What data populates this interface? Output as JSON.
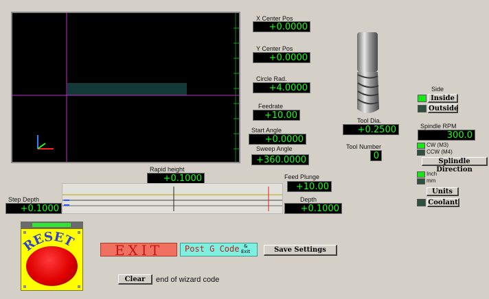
{
  "preview": {},
  "dros": {
    "x_center": {
      "label": "X Center Pos",
      "value": "+0.0000"
    },
    "y_center": {
      "label": "Y Center Pos",
      "value": "+0.0000"
    },
    "circle_rad": {
      "label": "Circle Rad.",
      "value": "+4.0000"
    },
    "feedrate": {
      "label": "Feedrate",
      "value": "+10.00"
    },
    "start_angle": {
      "label": "Start Angle",
      "value": "+0.0000"
    },
    "sweep_angle": {
      "label": "Sweep Angle",
      "value": "+360.0000"
    },
    "tool_dia": {
      "label": "Tool Dia.",
      "value": "+0.2500"
    },
    "tool_number": {
      "label": "Tool Number",
      "value": "0"
    },
    "spindle_rpm": {
      "label": "Spindle RPM",
      "value": "300.0"
    },
    "rapid_height": {
      "label": "Rapid height",
      "value": "+0.1000"
    },
    "feed_plunge": {
      "label": "Feed Plunge",
      "value": "+10.00"
    },
    "depth": {
      "label": "Depth",
      "value": "+0.1000"
    },
    "step_depth": {
      "label": "Step Depth",
      "value": "+0.1000"
    }
  },
  "side": {
    "title": "Side",
    "inside_label": "Inside",
    "outside_label": "Outside",
    "inside_active": true
  },
  "spindle": {
    "cw_label": "CW (M3)",
    "ccw_label": "CCW (M4)",
    "direction_button": "Splindle Direction",
    "cw_active": true
  },
  "units": {
    "inch_label": "Inch",
    "mm_label": "mm",
    "button": "Units",
    "inch_active": true
  },
  "coolant": {
    "button": "Coolant",
    "active": false
  },
  "reset": {
    "label": "RESET"
  },
  "exit": {
    "label": "EXIT"
  },
  "post": {
    "label": "Post G Code",
    "small_top": "&",
    "small_bottom": "Exit"
  },
  "save": {
    "label": "Save Settings"
  },
  "clear": {
    "label": "Clear",
    "note": "end of wizard code"
  },
  "colors": {
    "dro_text": "#19ff19",
    "led_on": "#19e619",
    "exit_bg": "#f07060",
    "exit_text": "#c01818",
    "post_bg": "#7ff0e0",
    "reset_red": "#e00000",
    "reset_yellow": "#ffff00"
  }
}
